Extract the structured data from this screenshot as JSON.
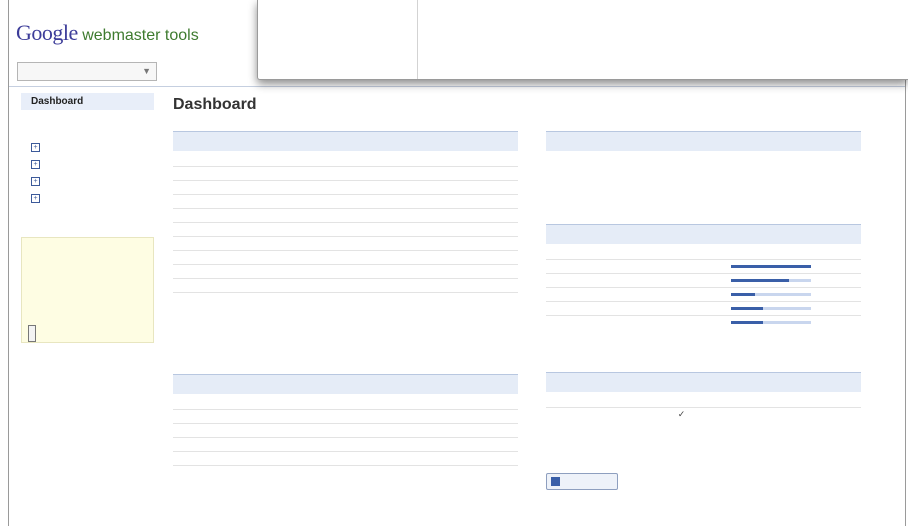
{
  "header": {
    "logo_word": "Google",
    "logo_sub": "webmaster tools",
    "site_selector": ""
  },
  "sidebar": {
    "items": [
      {
        "label": "Dashboard",
        "active": true
      },
      {
        "label": ""
      },
      {
        "label": "",
        "expander": "+"
      },
      {
        "label": "",
        "expander": "+"
      },
      {
        "label": "",
        "expander": "+"
      },
      {
        "label": "",
        "expander": "+"
      }
    ],
    "help": {
      "lines": [
        "",
        "",
        "",
        "",
        "",
        ""
      ],
      "language_button": ""
    }
  },
  "main": {
    "title": "Dashboard",
    "queries_panel": {
      "title": "",
      "columns": [
        "",
        "",
        ""
      ],
      "rows": [
        {
          "query": "",
          "impressions": "",
          "clicks": ""
        },
        {
          "query": "",
          "impressions": "",
          "clicks": ""
        },
        {
          "query": "",
          "impressions": "",
          "clicks": ""
        },
        {
          "query": "",
          "impressions": "",
          "clicks": ""
        },
        {
          "query": "",
          "impressions": "",
          "clicks": ""
        },
        {
          "query": "",
          "impressions": "",
          "clicks": ""
        },
        {
          "query": "",
          "impressions": "",
          "clicks": ""
        },
        {
          "query": "",
          "impressions": "",
          "clicks": ""
        },
        {
          "query": "",
          "impressions": "",
          "clicks": ""
        },
        {
          "query": "",
          "impressions": "",
          "clicks": ""
        }
      ],
      "date_range": "",
      "more": ""
    },
    "links_panel": {
      "title": "",
      "columns": [
        "",
        ""
      ],
      "rows": [
        {
          "domain": "",
          "links": "",
          "link": false
        },
        {
          "domain": "",
          "links": "",
          "link": true
        },
        {
          "domain": "",
          "links": "",
          "link": false
        },
        {
          "domain": "",
          "links": "",
          "link": true
        },
        {
          "domain": "",
          "links": "",
          "link": false
        }
      ],
      "more": ""
    },
    "crawl_panel": {
      "title": "",
      "row_label": "",
      "row_value": "",
      "updated": "",
      "more": ""
    },
    "keywords_panel": {
      "title": "",
      "columns": [
        "",
        ""
      ],
      "rows": [
        {
          "keyword": "",
          "significance": 1.0
        },
        {
          "keyword": "",
          "significance": 0.72
        },
        {
          "keyword": "",
          "significance": 0.3
        },
        {
          "keyword": "",
          "significance": 0.4
        },
        {
          "keyword": "",
          "significance": 0.4
        }
      ],
      "more": ""
    },
    "sitemaps_panel": {
      "title": "",
      "columns": [
        "",
        "",
        ""
      ],
      "rows": [
        {
          "sitemap": "",
          "status": "✓",
          "urls": ""
        }
      ],
      "more": ""
    },
    "gadget": {
      "button_label": "",
      "note": ""
    }
  },
  "search_preview": {
    "title": "",
    "lines": [
      "",
      "",
      ""
    ]
  },
  "colors": {
    "link": "#2a4e96",
    "panel_header": "#e5ecf7",
    "bar": "#3a5fa8",
    "help_bg": "#fefde3",
    "logo_green": "#3e7b2f"
  }
}
